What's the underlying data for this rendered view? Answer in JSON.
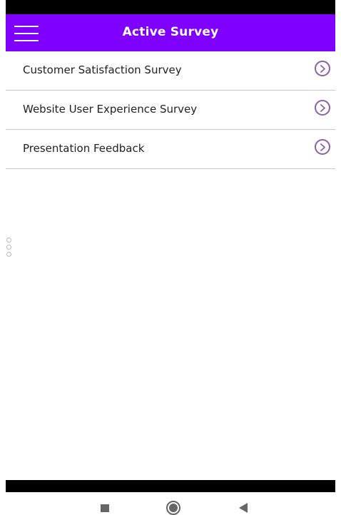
{
  "header": {
    "title": "Active Survey",
    "menu_icon": "hamburger-menu-icon",
    "background_color": "#8000ff"
  },
  "surveys": [
    {
      "label": "Customer Satisfaction Survey",
      "icon": "chevron-right-circle-icon"
    },
    {
      "label": "Website User Experience Survey",
      "icon": "chevron-right-circle-icon"
    },
    {
      "label": "Presentation Feedback",
      "icon": "chevron-right-circle-icon"
    }
  ],
  "accent_color": "#8c5fa8",
  "nav_bar": {
    "recents_icon": "square-recents-icon",
    "home_icon": "circle-home-icon",
    "back_icon": "triangle-back-icon"
  }
}
